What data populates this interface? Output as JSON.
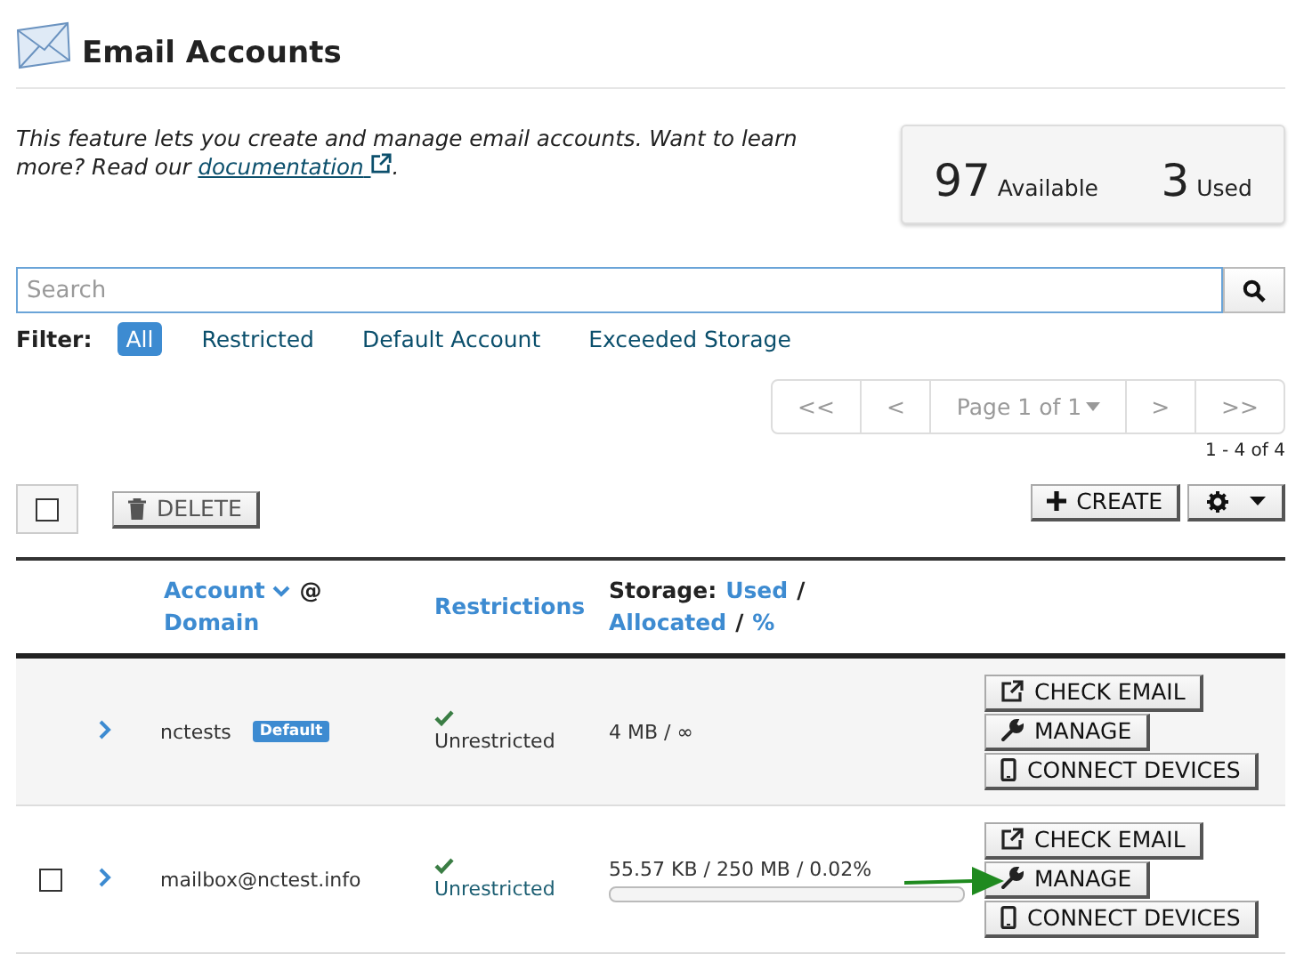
{
  "header": {
    "title": "Email Accounts"
  },
  "intro": {
    "text": "This feature lets you create and manage email accounts. Want to learn more? Read our ",
    "link": "documentation",
    "after": "."
  },
  "stats": [
    {
      "value": "97",
      "label": "Available"
    },
    {
      "value": "3",
      "label": "Used"
    }
  ],
  "search": {
    "placeholder": "Search"
  },
  "filter": {
    "label": "Filter:",
    "options": [
      {
        "label": "All",
        "selected": true
      },
      {
        "label": "Restricted",
        "selected": false
      },
      {
        "label": "Default Account",
        "selected": false
      },
      {
        "label": "Exceeded Storage",
        "selected": false
      }
    ]
  },
  "pagination": {
    "buttons": [
      {
        "label": "<<",
        "kind": "nav"
      },
      {
        "label": "<",
        "kind": "nav"
      },
      {
        "label": "Page 1 of 1",
        "kind": "page"
      },
      {
        "label": ">",
        "kind": "nav"
      },
      {
        "label": ">>",
        "kind": "nav"
      }
    ],
    "count": "1 - 4 of 4"
  },
  "toolbar": {
    "select_all_checked": false,
    "delete": "DELETE",
    "create": "CREATE"
  },
  "table": {
    "columns": [
      {
        "parts": [
          {
            "text": "Account",
            "kind": "sort-link",
            "sorted": true
          },
          {
            "text": "@",
            "kind": "text"
          },
          {
            "text": "Domain",
            "kind": "sort-link"
          }
        ]
      },
      {
        "parts": [
          {
            "text": "Restrictions",
            "kind": "sort-link"
          }
        ]
      },
      {
        "parts": [
          {
            "text": "Storage:",
            "kind": "text"
          },
          {
            "text": "Used",
            "kind": "sort-link"
          },
          {
            "text": "/",
            "kind": "text"
          },
          {
            "text": "Allocated",
            "kind": "sort-link"
          },
          {
            "text": "/",
            "kind": "text"
          },
          {
            "text": "%",
            "kind": "sort-link"
          }
        ]
      }
    ],
    "rows": [
      {
        "account": "nctests",
        "badge": "Default",
        "restriction": "Unrestricted",
        "storage": "4 MB / ∞",
        "actions": [
          {
            "label": "CHECK EMAIL",
            "kind": "external",
            "pointed": false
          },
          {
            "label": "MANAGE",
            "kind": "wrench",
            "pointed": false
          },
          {
            "label": "CONNECT DEVICES",
            "kind": "phone",
            "pointed": false
          }
        ]
      },
      {
        "checked": false,
        "account": "mailbox@nctest.info",
        "restriction": "Unrestricted",
        "storage": "55.57 KB / 250 MB / 0.02%",
        "level": 0.0002,
        "actions": [
          {
            "label": "CHECK EMAIL",
            "kind": "external",
            "pointed": false
          },
          {
            "label": "MANAGE",
            "kind": "wrench",
            "pointed": true
          },
          {
            "label": "CONNECT DEVICES",
            "kind": "phone",
            "pointed": false
          }
        ]
      }
    ]
  }
}
